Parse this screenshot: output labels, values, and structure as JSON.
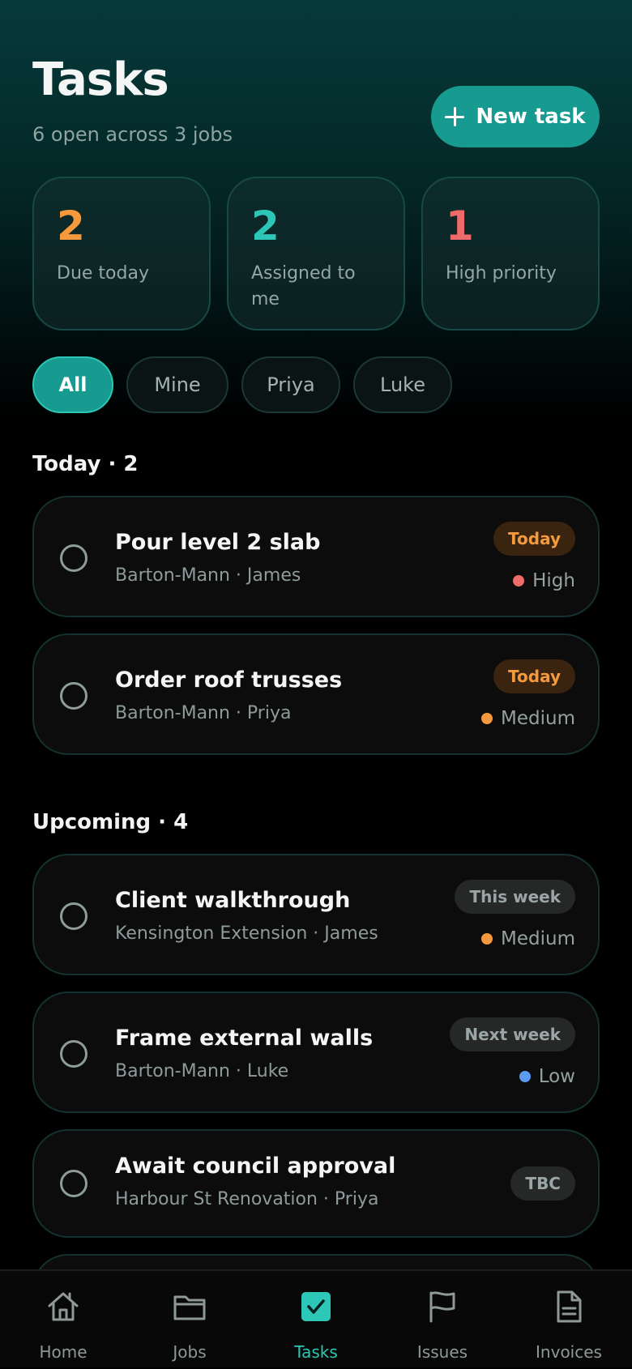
{
  "header": {
    "title": "Tasks",
    "subtitle": "6 open across 3 jobs",
    "new_task_label": "New task"
  },
  "stats": [
    {
      "value": "2",
      "label": "Due today",
      "color": "#f49a3c"
    },
    {
      "value": "2",
      "label": "Assigned to me",
      "color": "#2cc7b6"
    },
    {
      "value": "1",
      "label": "High priority",
      "color": "#ef6b6b"
    }
  ],
  "filters": [
    {
      "label": "All",
      "active": true
    },
    {
      "label": "Mine",
      "active": false
    },
    {
      "label": "Priya",
      "active": false
    },
    {
      "label": "Luke",
      "active": false
    }
  ],
  "sections": {
    "today": {
      "heading": "Today · 2",
      "tasks": [
        {
          "title": "Pour level 2 slab",
          "meta": "Barton-Mann · James",
          "due": "Today",
          "priority": "High",
          "priority_color": "#ef6b6b"
        },
        {
          "title": "Order roof trusses",
          "meta": "Barton-Mann · Priya",
          "due": "Today",
          "priority": "Medium",
          "priority_color": "#f49a3c"
        }
      ]
    },
    "upcoming": {
      "heading": "Upcoming · 4",
      "tasks": [
        {
          "title": "Client walkthrough",
          "meta": "Kensington Extension · James",
          "due": "This week",
          "priority": "Medium",
          "priority_color": "#f49a3c"
        },
        {
          "title": "Frame external walls",
          "meta": "Barton-Mann · Luke",
          "due": "Next week",
          "priority": "Low",
          "priority_color": "#5b9bf0"
        },
        {
          "title": "Await council approval",
          "meta": "Harbour St Renovation · Priya",
          "due": "TBC"
        }
      ]
    }
  },
  "nav": {
    "items": [
      {
        "label": "Home",
        "icon": "home-icon"
      },
      {
        "label": "Jobs",
        "icon": "folder-icon"
      },
      {
        "label": "Tasks",
        "icon": "checkbox-icon",
        "active": true
      },
      {
        "label": "Issues",
        "icon": "flag-icon"
      },
      {
        "label": "Invoices",
        "icon": "document-icon"
      }
    ],
    "accent_color": "#2cc7b6"
  },
  "colors": {
    "accent": "#179a8f",
    "background": "#000000"
  }
}
